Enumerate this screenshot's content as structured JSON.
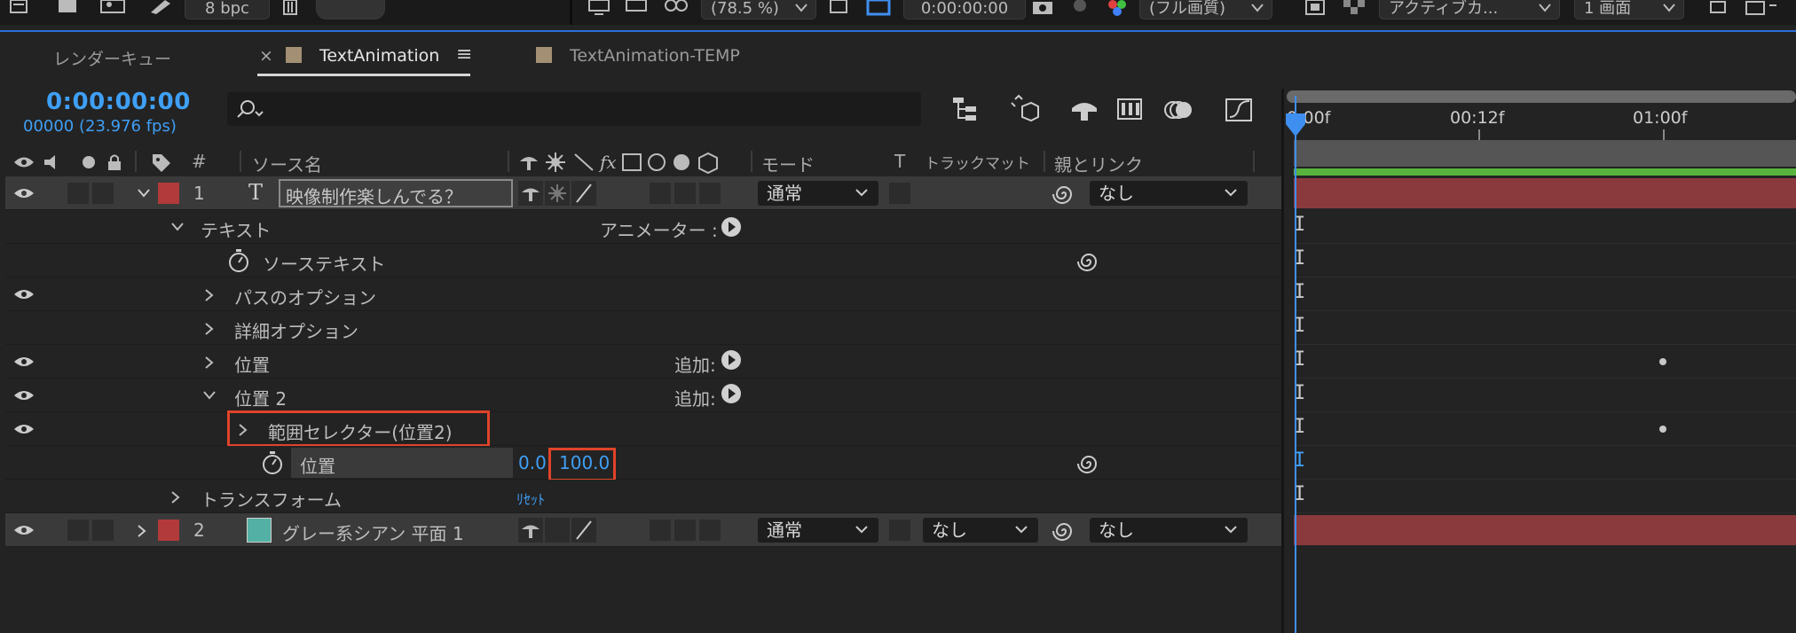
{
  "topbar": {
    "bpc": "8 bpc",
    "zoom": "(78.5 %)",
    "time": "0:00:00:00",
    "quality": "(フル画質)",
    "camera": "アクティブカ...",
    "views": "1 画面"
  },
  "tabs": [
    {
      "label": "レンダーキュー"
    },
    {
      "label": "TextAnimation",
      "close": "×",
      "menu": "≡"
    },
    {
      "label": "TextAnimation-TEMP"
    }
  ],
  "comp": {
    "timecode": "0:00:00:00",
    "frames_fps": "00000 (23.976 fps)",
    "search_placeholder": ""
  },
  "columns": {
    "num": "#",
    "source_name": "ソース名",
    "mode": "モード",
    "t": "T",
    "trackmatte": "トラックマット",
    "parent": "親とリンク"
  },
  "layers": {
    "layer1": {
      "num": "1",
      "type_icon": "T",
      "name": "映像制作楽しんでる？",
      "mode": "通常",
      "parent": "なし"
    },
    "text_group": {
      "label": "テキスト",
      "animator": "アニメーター :"
    },
    "source_text": "ソーステキスト",
    "path_options": "パスのオプション",
    "more_options": "詳細オプション",
    "position": {
      "label": "位置",
      "add": "追加:"
    },
    "position2": {
      "label": "位置 2",
      "add": "追加:"
    },
    "range_selector": "範囲セレクター(位置2)",
    "position_prop": {
      "label": "位置",
      "x": "0.0",
      "y": "100.0"
    },
    "transform": {
      "label": "トランスフォーム",
      "reset": "ﾘｾｯﾄ"
    },
    "layer2": {
      "num": "2",
      "name": "グレー系シアン 平面 1",
      "mode": "通常",
      "trackmatte": "なし",
      "parent": "なし"
    }
  },
  "timeline": {
    "ticks": [
      "0:00f",
      "00:12f",
      "01:00f"
    ]
  },
  "colors": {
    "accent_blue": "#3f9ff5",
    "label_red": "#b33a3a",
    "solid_cyan": "#53b0a4",
    "highlight": "#e0432a",
    "work_area_green": "#57b33e"
  }
}
